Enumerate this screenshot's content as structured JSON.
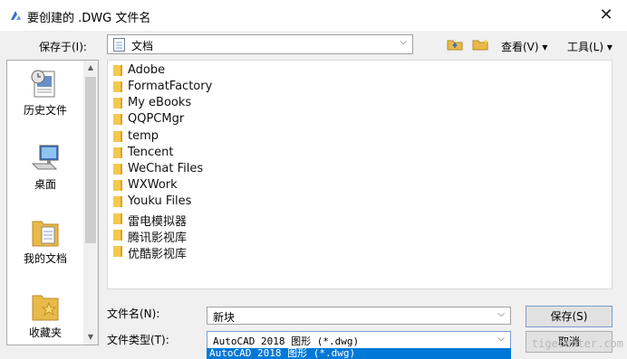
{
  "window": {
    "title": "要创建的 .DWG 文件名",
    "close_glyph": "✕"
  },
  "toolbar": {
    "save_in_label": "保存于(I):",
    "save_in_value": "文档",
    "view_menu": "查看(V) ▾",
    "tools_menu": "工具(L) ▾"
  },
  "places": [
    {
      "label": "历史文件",
      "icon": "history-icon"
    },
    {
      "label": "桌面",
      "icon": "desktop-icon"
    },
    {
      "label": "我的文档",
      "icon": "my-documents-icon"
    },
    {
      "label": "收藏夹",
      "icon": "favorites-icon"
    }
  ],
  "files": [
    "Adobe",
    "FormatFactory",
    "My eBooks",
    "QQPCMgr",
    "temp",
    "Tencent",
    "WeChat Files",
    "WXWork",
    "Youku Files",
    "雷电模拟器",
    "腾讯影视库",
    "优酷影视库"
  ],
  "form": {
    "filename_label": "文件名(N):",
    "filename_value": "新块",
    "filetype_label": "文件类型(T):",
    "filetype_value": "AutoCAD 2018 图形 (*.dwg)",
    "dropdown_option": "AutoCAD 2018 图形 (*.dwg)"
  },
  "buttons": {
    "save": "保存(S)",
    "cancel": "取消"
  },
  "watermark": "tigerenter.com"
}
